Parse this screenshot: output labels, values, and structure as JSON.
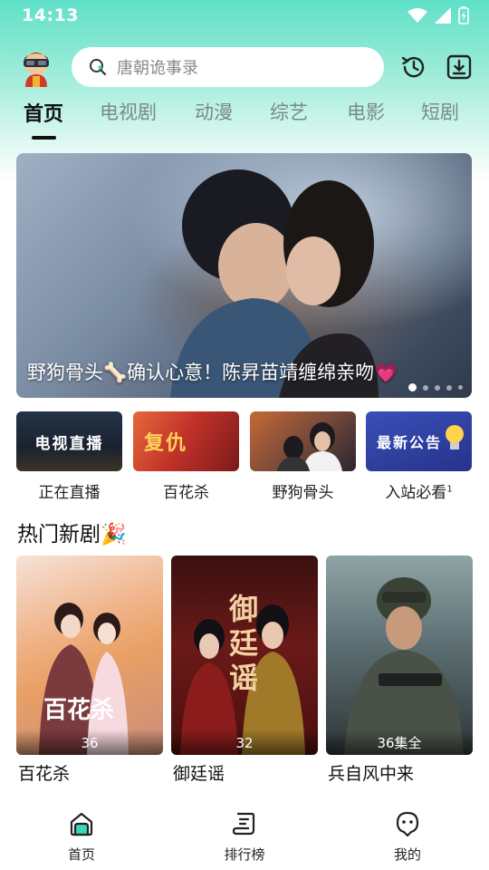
{
  "status": {
    "time": "14:13"
  },
  "search": {
    "placeholder": "唐朝诡事录"
  },
  "tabs": [
    {
      "label": "首页",
      "active": true
    },
    {
      "label": "电视剧"
    },
    {
      "label": "动漫"
    },
    {
      "label": "综艺"
    },
    {
      "label": "电影"
    },
    {
      "label": "短剧"
    }
  ],
  "banner": {
    "title": "野狗骨头🦴确认心意！陈昇苗靖缠绵亲吻💗",
    "dots": 5,
    "active_dot": 0
  },
  "quick_entries": [
    {
      "label": "正在直播",
      "thumb_text": "电视直播"
    },
    {
      "label": "百花杀",
      "thumb_text": "复仇"
    },
    {
      "label": "野狗骨头",
      "thumb_text": ""
    },
    {
      "label": "入站必看",
      "superscript": "1",
      "thumb_text": "最新公告"
    }
  ],
  "section": {
    "title": "热门新剧🎉"
  },
  "dramas": [
    {
      "title": "百花杀",
      "count": "36",
      "poster_text": "百花杀"
    },
    {
      "title": "御廷谣",
      "count": "32",
      "poster_text": "御廷谣"
    },
    {
      "title": "兵自风中来",
      "count": "36集全",
      "poster_text": ""
    }
  ],
  "bottom_nav": [
    {
      "label": "首页",
      "icon": "home-icon",
      "active": true
    },
    {
      "label": "排行榜",
      "icon": "ranking-icon"
    },
    {
      "label": "我的",
      "icon": "profile-icon"
    }
  ],
  "colors": {
    "accent": "#3ad6b5",
    "header_gradient_top": "#5fe0c7"
  }
}
